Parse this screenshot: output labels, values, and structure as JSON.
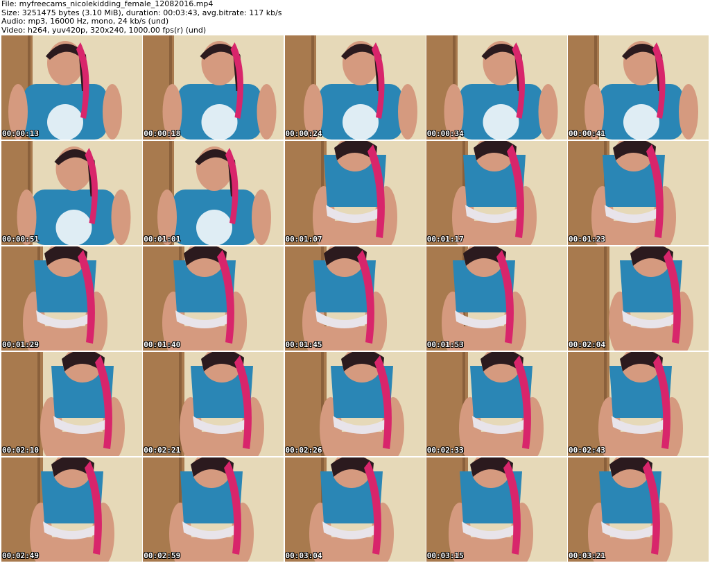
{
  "header": {
    "file_line": "File: myfreecams_nicolekidding_female_12082016.mp4",
    "size_line": "Size: 3251475 bytes (3.10 MiB), duration: 00:03:43, avg.bitrate: 117 kb/s",
    "audio_line": "Audio: mp3, 16000 Hz, mono, 24 kb/s (und)",
    "video_line": "Video: h264, yuv420p, 320x240, 1000.00 fps(r) (und)"
  },
  "thumbnails": [
    {
      "timestamp": "00:00:13"
    },
    {
      "timestamp": "00:00:18"
    },
    {
      "timestamp": "00:00:24"
    },
    {
      "timestamp": "00:00:34"
    },
    {
      "timestamp": "00:00:41"
    },
    {
      "timestamp": "00:00:51"
    },
    {
      "timestamp": "00:01:01"
    },
    {
      "timestamp": "00:01:07"
    },
    {
      "timestamp": "00:01:17"
    },
    {
      "timestamp": "00:01:23"
    },
    {
      "timestamp": "00:01:29"
    },
    {
      "timestamp": "00:01:40"
    },
    {
      "timestamp": "00:01:45"
    },
    {
      "timestamp": "00:01:53"
    },
    {
      "timestamp": "00:02:04"
    },
    {
      "timestamp": "00:02:10"
    },
    {
      "timestamp": "00:02:21"
    },
    {
      "timestamp": "00:02:26"
    },
    {
      "timestamp": "00:02:33"
    },
    {
      "timestamp": "00:02:43"
    },
    {
      "timestamp": "00:02:49"
    },
    {
      "timestamp": "00:02:59"
    },
    {
      "timestamp": "00:03:04"
    },
    {
      "timestamp": "00:03:15"
    },
    {
      "timestamp": "00:03:21"
    }
  ],
  "colors": {
    "background": "#ffffff",
    "wall": "#e6d9b8",
    "door": "#a87a4e",
    "shirt": "#2a86b5",
    "hair": "#2b1a1e",
    "hair_accent": "#d8256b",
    "skin": "#d59a7f",
    "shorts": "#e8e4ea"
  }
}
